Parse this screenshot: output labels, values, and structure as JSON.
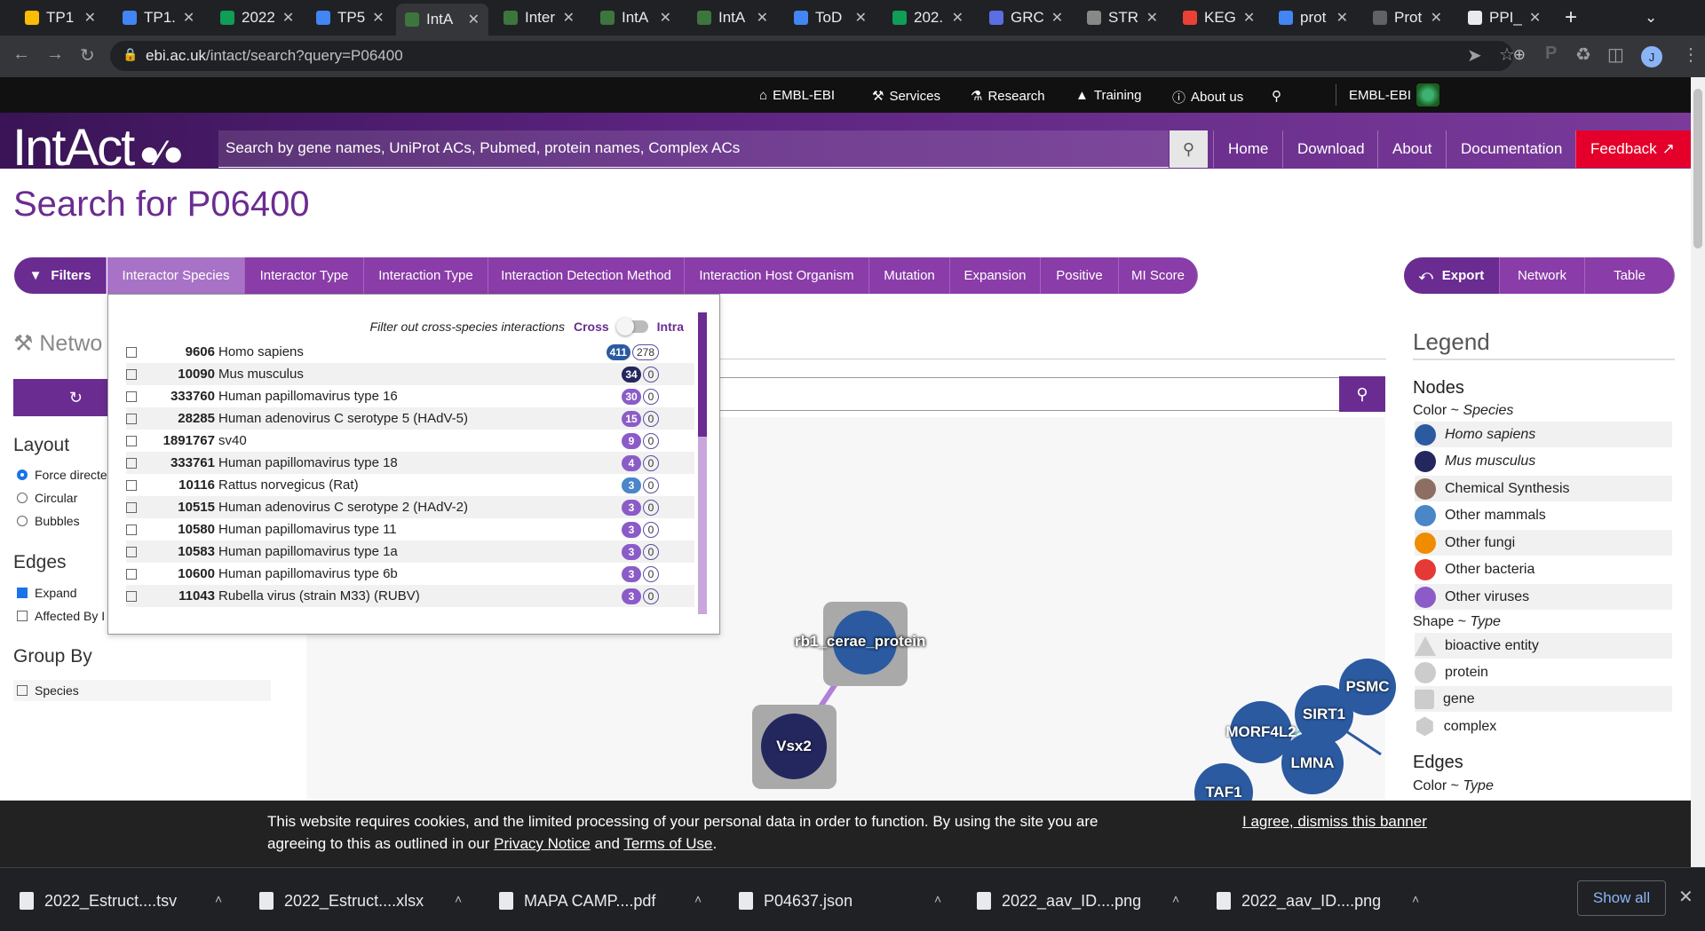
{
  "browser": {
    "tabs": [
      {
        "label": "TP1",
        "color": "#fbbc04"
      },
      {
        "label": "TP1.",
        "color": "#4285f4"
      },
      {
        "label": "2022",
        "color": "#0f9d58"
      },
      {
        "label": "TP5",
        "color": "#4285f4"
      },
      {
        "label": "IntA",
        "color": "#3c763d"
      },
      {
        "label": "Inter",
        "color": "#3c763d"
      },
      {
        "label": "IntA",
        "color": "#3c763d"
      },
      {
        "label": "IntA",
        "color": "#3c763d"
      },
      {
        "label": "ToD",
        "color": "#4285f4"
      },
      {
        "label": "202.",
        "color": "#0f9d58"
      },
      {
        "label": "GRC",
        "color": "#5b6ee1"
      },
      {
        "label": "STR",
        "color": "#888888"
      },
      {
        "label": "KEG",
        "color": "#e94235"
      },
      {
        "label": "prot",
        "color": "#4285f4"
      },
      {
        "label": "Prot",
        "color": "#5f6368"
      },
      {
        "label": "PPI_",
        "color": "#e8eaed"
      }
    ],
    "url_host": "ebi.ac.uk",
    "url_path": "/intact/search?query=P06400",
    "profile_initial": "J"
  },
  "ebi": {
    "links": [
      "EMBL-EBI",
      "Services",
      "Research",
      "Training",
      "About us"
    ],
    "brand": "EMBL-EBI"
  },
  "intact": {
    "logo": "IntAct",
    "search_placeholder": "Search by gene names, UniProt ACs, Pubmed, protein names, Complex ACs",
    "nav": [
      "Home",
      "Download",
      "About",
      "Documentation"
    ],
    "feedback": "Feedback"
  },
  "page": {
    "title": "Search for P06400",
    "filters_label": "Filters",
    "filter_tabs": [
      "Interactor Species",
      "Interactor Type",
      "Interaction Type",
      "Interaction Detection Method",
      "Interaction Host Organism",
      "Mutation",
      "Expansion",
      "Positive",
      "MI Score"
    ],
    "export_label": "Export",
    "view_tabs": [
      "Network",
      "Table"
    ]
  },
  "species_filter": {
    "caption": "Filter out cross-species interactions",
    "cross": "Cross",
    "intra": "Intra",
    "rows": [
      {
        "taxid": "9606",
        "name": "Homo sapiens",
        "c1": "411",
        "c2": "278",
        "color": "#2b5aa0"
      },
      {
        "taxid": "10090",
        "name": "Mus musculus",
        "c1": "34",
        "c2": "0",
        "color": "#23275e"
      },
      {
        "taxid": "333760",
        "name": "Human papillomavirus type 16",
        "c1": "30",
        "c2": "0",
        "color": "#8b5cc7"
      },
      {
        "taxid": "28285",
        "name": "Human adenovirus C serotype 5 (HAdV-5)",
        "c1": "15",
        "c2": "0",
        "color": "#8b5cc7"
      },
      {
        "taxid": "1891767",
        "name": "sv40",
        "c1": "9",
        "c2": "0",
        "color": "#8b5cc7"
      },
      {
        "taxid": "333761",
        "name": "Human papillomavirus type 18",
        "c1": "4",
        "c2": "0",
        "color": "#8b5cc7"
      },
      {
        "taxid": "10116",
        "name": "Rattus norvegicus (Rat)",
        "c1": "3",
        "c2": "0",
        "color": "#4a86c8"
      },
      {
        "taxid": "10515",
        "name": "Human adenovirus C serotype 2 (HAdV-2)",
        "c1": "3",
        "c2": "0",
        "color": "#8b5cc7"
      },
      {
        "taxid": "10580",
        "name": "Human papillomavirus type 11",
        "c1": "3",
        "c2": "0",
        "color": "#8b5cc7"
      },
      {
        "taxid": "10583",
        "name": "Human papillomavirus type 1a",
        "c1": "3",
        "c2": "0",
        "color": "#8b5cc7"
      },
      {
        "taxid": "10600",
        "name": "Human papillomavirus type 6b",
        "c1": "3",
        "c2": "0",
        "color": "#8b5cc7"
      },
      {
        "taxid": "11043",
        "name": "Rubella virus (strain M33) (RUBV)",
        "c1": "3",
        "c2": "0",
        "color": "#8b5cc7"
      }
    ]
  },
  "left_panel": {
    "network_heading": "Netwo",
    "layout_heading": "Layout",
    "layout_options": [
      "Force directe",
      "Circular",
      "Bubbles"
    ],
    "edges_heading": "Edges",
    "edge_options": [
      "Expand",
      "Affected By I"
    ],
    "group_heading": "Group By",
    "group_options": [
      "Species"
    ]
  },
  "network": {
    "nodes": [
      "rb1_cerae_protein",
      "Vsx2",
      "PSMC",
      "SIRT1",
      "MORF4L2",
      "LMNA",
      "TAF1"
    ]
  },
  "legend": {
    "title": "Legend",
    "nodes_heading": "Nodes",
    "color_label": "Color ~ ",
    "color_kind": "Species",
    "species": [
      {
        "name": "Homo sapiens",
        "color": "#2b5aa0",
        "italic": true
      },
      {
        "name": "Mus musculus",
        "color": "#23275e",
        "italic": true
      },
      {
        "name": "Chemical Synthesis",
        "color": "#8d6e63",
        "italic": false
      },
      {
        "name": "Other mammals",
        "color": "#4a86c8",
        "italic": false
      },
      {
        "name": "Other fungi",
        "color": "#ef8c00",
        "italic": false
      },
      {
        "name": "Other bacteria",
        "color": "#e53935",
        "italic": false
      },
      {
        "name": "Other viruses",
        "color": "#8b5cc7",
        "italic": false
      }
    ],
    "shape_label": "Shape ~ ",
    "shape_kind": "Type",
    "shapes": [
      "bioactive entity",
      "protein",
      "gene",
      "complex"
    ],
    "edges_heading": "Edges",
    "edge_color_label": "Color ~ ",
    "edge_color_kind": "Type"
  },
  "cookie": {
    "text1": "This website requires cookies, and the limited processing of your personal data in order to function. By using the site you are",
    "text2_a": "agreeing to this as outlined in our ",
    "privacy": "Privacy Notice",
    "and": " and ",
    "terms": "Terms of Use",
    "dot": ".",
    "dismiss": "I agree, dismiss this banner"
  },
  "downloads": {
    "files": [
      "2022_Estruct....tsv",
      "2022_Estruct....xlsx",
      "MAPA CAMP....pdf",
      "P04637.json",
      "2022_aav_ID....png",
      "2022_aav_ID....png"
    ],
    "show_all": "Show all"
  }
}
